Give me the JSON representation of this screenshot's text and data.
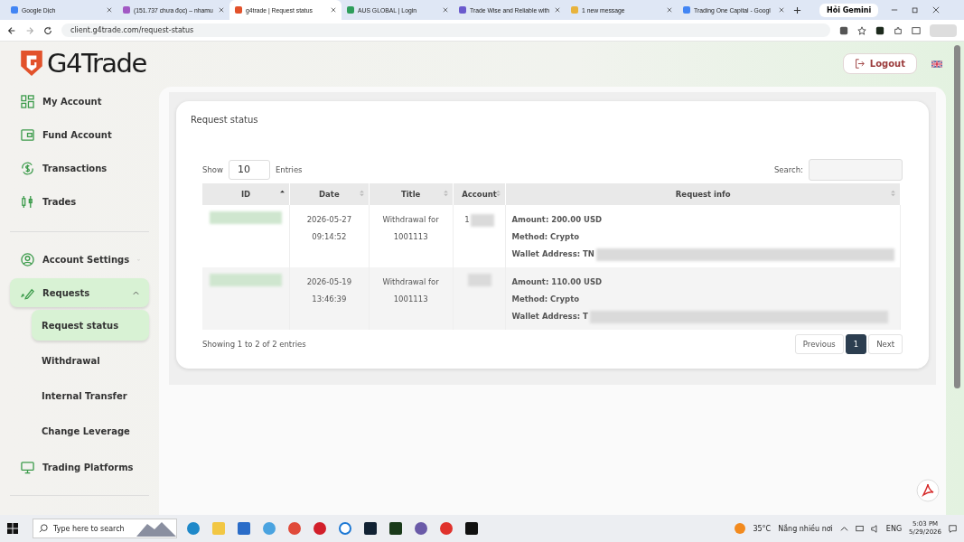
{
  "browser": {
    "tabs": [
      {
        "title": "Google Dịch",
        "selected": false
      },
      {
        "title": "(151.737 chưa đọc) – nhamu",
        "selected": false
      },
      {
        "title": "g4trade | Request status",
        "selected": true
      },
      {
        "title": "AUS GLOBAL | Login",
        "selected": false
      },
      {
        "title": "Trade Wise and Reliable with",
        "selected": false
      },
      {
        "title": "1 new message",
        "selected": false
      },
      {
        "title": "Trading One Capital - Googl",
        "selected": false
      }
    ],
    "gemini": "Hỏi Gemini",
    "url": "client.g4trade.com/request-status"
  },
  "header": {
    "logo": "G4Trade",
    "logout": "Logout"
  },
  "sidebar": {
    "main_items": [
      {
        "label": "My Account"
      },
      {
        "label": "Fund Account"
      },
      {
        "label": "Transactions"
      },
      {
        "label": "Trades"
      }
    ],
    "settings_items": [
      {
        "label": "Account Settings",
        "selected": false,
        "expanded": false
      },
      {
        "label": "Requests",
        "selected": true,
        "expanded": true,
        "children": [
          {
            "label": "Request status",
            "selected": true
          },
          {
            "label": "Withdrawal",
            "selected": false
          },
          {
            "label": "Internal Transfer",
            "selected": false
          },
          {
            "label": "Change Leverage",
            "selected": false
          }
        ]
      },
      {
        "label": "Trading Platforms",
        "selected": false,
        "expanded": false
      }
    ]
  },
  "card": {
    "title": "Request status",
    "show_label": "Show",
    "page_length": "10",
    "entries_label": "Entries",
    "search_label": "Search:",
    "columns": [
      {
        "label": "ID",
        "sorted": true
      },
      {
        "label": "Date",
        "sorted": false
      },
      {
        "label": "Title",
        "sorted": false
      },
      {
        "label": "Account",
        "sorted": false
      },
      {
        "label": "Request info",
        "sorted": false
      }
    ],
    "rows": [
      {
        "date": "2026-05-27 09:14:52",
        "title": "Withdrawal for 1001113",
        "account": "1",
        "info": [
          "Amount: 200.00 USD",
          "Method: Crypto",
          "Wallet Address: TN"
        ]
      },
      {
        "date": "2026-05-19 13:46:39",
        "title": "Withdrawal for 1001113",
        "info": [
          "Amount: 110.00 USD",
          "Method: Crypto",
          "Wallet Address: T"
        ]
      }
    ],
    "summary": "Showing 1 to 2 of 2 entries",
    "pager": [
      {
        "label": "Previous",
        "selected": false
      },
      {
        "label": "1",
        "selected": true
      },
      {
        "label": "Next",
        "selected": false
      }
    ]
  },
  "taskbar": {
    "search_placeholder": "Type here to search",
    "temperature": "35°C",
    "weather": "Nắng nhiều nơi",
    "language": "ENG",
    "time": "5:03 PM",
    "date": "5/29/2026"
  }
}
